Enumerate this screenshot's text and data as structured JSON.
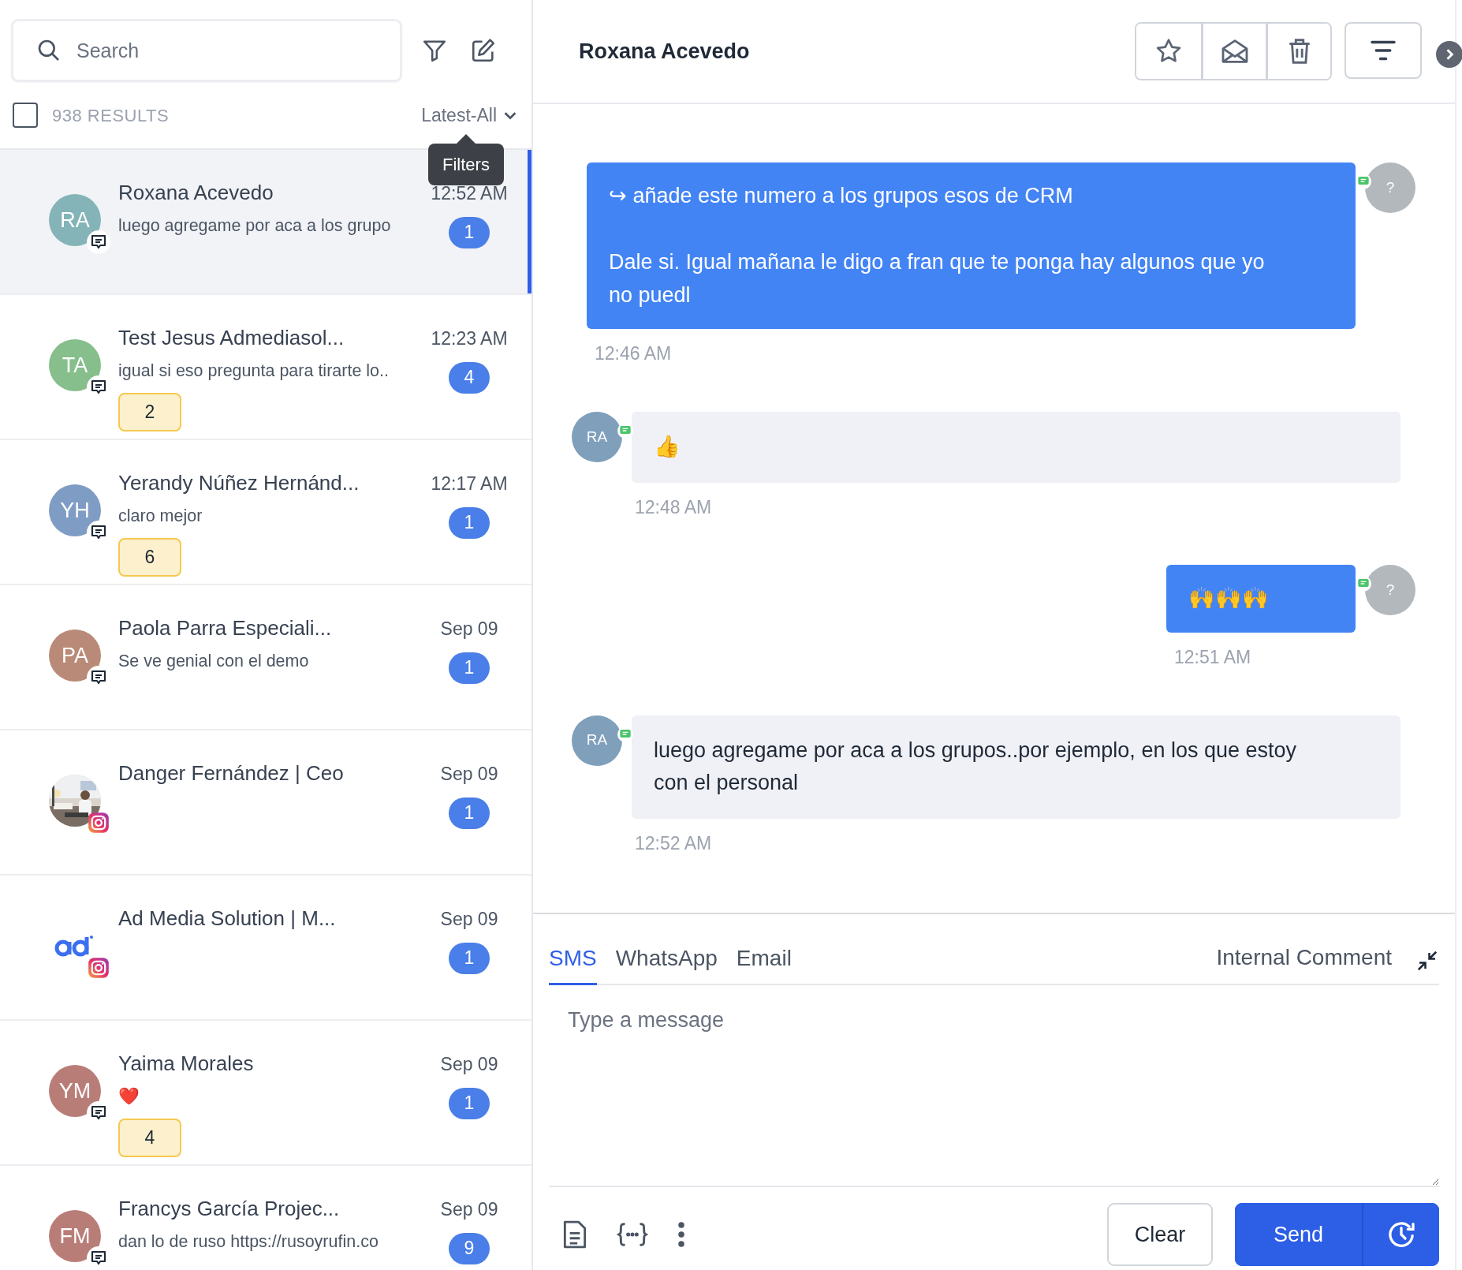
{
  "search": {
    "placeholder": "Search"
  },
  "results": {
    "checked": false,
    "count": "938 RESULTS",
    "sort": "Latest-All"
  },
  "tooltip": "Filters",
  "conversations": [
    {
      "avatar": {
        "kind": "initials",
        "initials": "RA",
        "color": "#84b4b8"
      },
      "badge": {
        "kind": "sms"
      },
      "name": "Roxana Acevedo",
      "preview": "luego agregame por aca a los grupo",
      "time": "12:52 AM",
      "unread": "1",
      "selected": true
    },
    {
      "avatar": {
        "kind": "initials",
        "initials": "TA",
        "color": "#86bf8c"
      },
      "badge": {
        "kind": "sms"
      },
      "name": "Test Jesus Admediasol...",
      "preview": "igual si eso pregunta para tirarte lo..",
      "time": "12:23 AM",
      "unread": "4",
      "tag": "2",
      "selected": false
    },
    {
      "avatar": {
        "kind": "initials",
        "initials": "YH",
        "color": "#7f9cc4"
      },
      "badge": {
        "kind": "sms"
      },
      "name": "Yerandy Núñez Hernánd...",
      "preview": "claro mejor",
      "time": "12:17 AM",
      "unread": "1",
      "tag": "6",
      "selected": false
    },
    {
      "avatar": {
        "kind": "initials",
        "initials": "PA",
        "color": "#b98a78"
      },
      "badge": {
        "kind": "sms"
      },
      "name": "Paola Parra Especiali...",
      "preview": "Se ve genial con el demo",
      "time": "Sep 09",
      "unread": "1",
      "selected": false
    },
    {
      "badge": {
        "kind": "instagram"
      },
      "name": "Danger Fernández | Ceo",
      "time": "Sep 09",
      "unread": "1",
      "selected": false
    },
    {
      "avatar": {
        "kind": "logo"
      },
      "badge": {
        "kind": "instagram"
      },
      "name": "Ad Media Solution | M...",
      "time": "Sep 09",
      "unread": "1",
      "selected": false
    },
    {
      "avatar": {
        "kind": "initials",
        "initials": "YM",
        "color": "#b97d78"
      },
      "badge": {
        "kind": "sms"
      },
      "name": "Yaima Morales",
      "preview": "❤️",
      "time": "Sep 09",
      "unread": "1",
      "tag": "4",
      "selected": false
    },
    {
      "avatar": {
        "kind": "initials",
        "initials": "FM",
        "color": "#b97d78"
      },
      "badge": {
        "kind": "sms"
      },
      "name": "Francys García Projec...",
      "preview": "dan lo de ruso https://rusoyrufin.co",
      "time": "Sep 09",
      "unread": "9",
      "selected": false
    }
  ],
  "header": {
    "title": "Roxana Acevedo"
  },
  "messages": [
    {
      "kind": "out",
      "avatar": "?",
      "text": "↪ añade este numero a los grupos esos de CRM\n\n Dale si. Igual mañana le digo a fran que te ponga hay algunos que yo no puedl",
      "time": "12:46 AM"
    },
    {
      "kind": "in",
      "avatar": "RA",
      "text": "👍",
      "time": "12:48 AM"
    },
    {
      "kind": "out",
      "avatar": "?",
      "text": "🙌🙌🙌",
      "time": "12:51 AM"
    },
    {
      "kind": "in",
      "avatar": "RA",
      "text": "luego agregame por aca a los grupos..por ejemplo, en los que estoy con el personal",
      "time": "12:52 AM"
    }
  ],
  "composer": {
    "tabs": [
      {
        "label": "SMS",
        "selected": true
      },
      {
        "label": "WhatsApp",
        "selected": false
      },
      {
        "label": "Email",
        "selected": false
      }
    ],
    "internal": "Internal Comment",
    "placeholder": "Type a message",
    "clear": "Clear",
    "send": "Send"
  }
}
